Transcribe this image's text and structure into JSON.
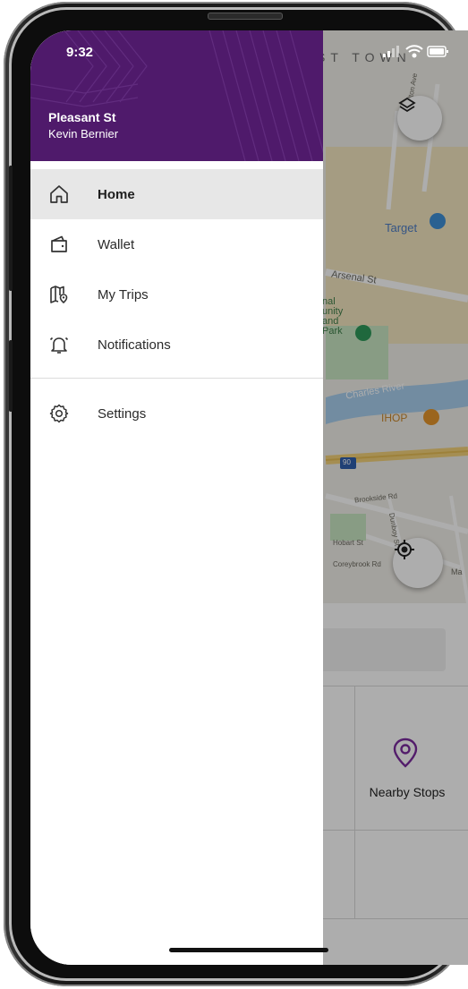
{
  "status_bar": {
    "time": "9:32"
  },
  "drawer": {
    "place": "Pleasant St",
    "user": "Kevin Bernier",
    "items": [
      {
        "label": "Home",
        "icon": "home-icon",
        "active": true
      },
      {
        "label": "Wallet",
        "icon": "wallet-icon",
        "active": false
      },
      {
        "label": "My Trips",
        "icon": "map-pin-icon",
        "active": false
      },
      {
        "label": "Notifications",
        "icon": "bell-icon",
        "active": false
      },
      {
        "label": "Settings",
        "icon": "gear-icon",
        "active": false
      }
    ]
  },
  "map": {
    "area_label": "ST TOWN",
    "labels": {
      "target": "Target",
      "arsenal": "Arsenal St",
      "park": "nal\nunity\nand\nPark",
      "river": "Charles River",
      "ihop": "IHOP",
      "highway": "90",
      "brookside": "Brookside Rd",
      "hobart": "Hobart St",
      "dunboy": "Dunboy St",
      "corey": "Coreybrook Rd",
      "elton": "Elton Ave",
      "ma": "Ma"
    }
  },
  "panel": {
    "nearby_label": "Nearby Stops"
  },
  "colors": {
    "drawer_header": "#4f1a6b",
    "accent": "#6a2a8c",
    "active_row": "#e7e7e7"
  }
}
